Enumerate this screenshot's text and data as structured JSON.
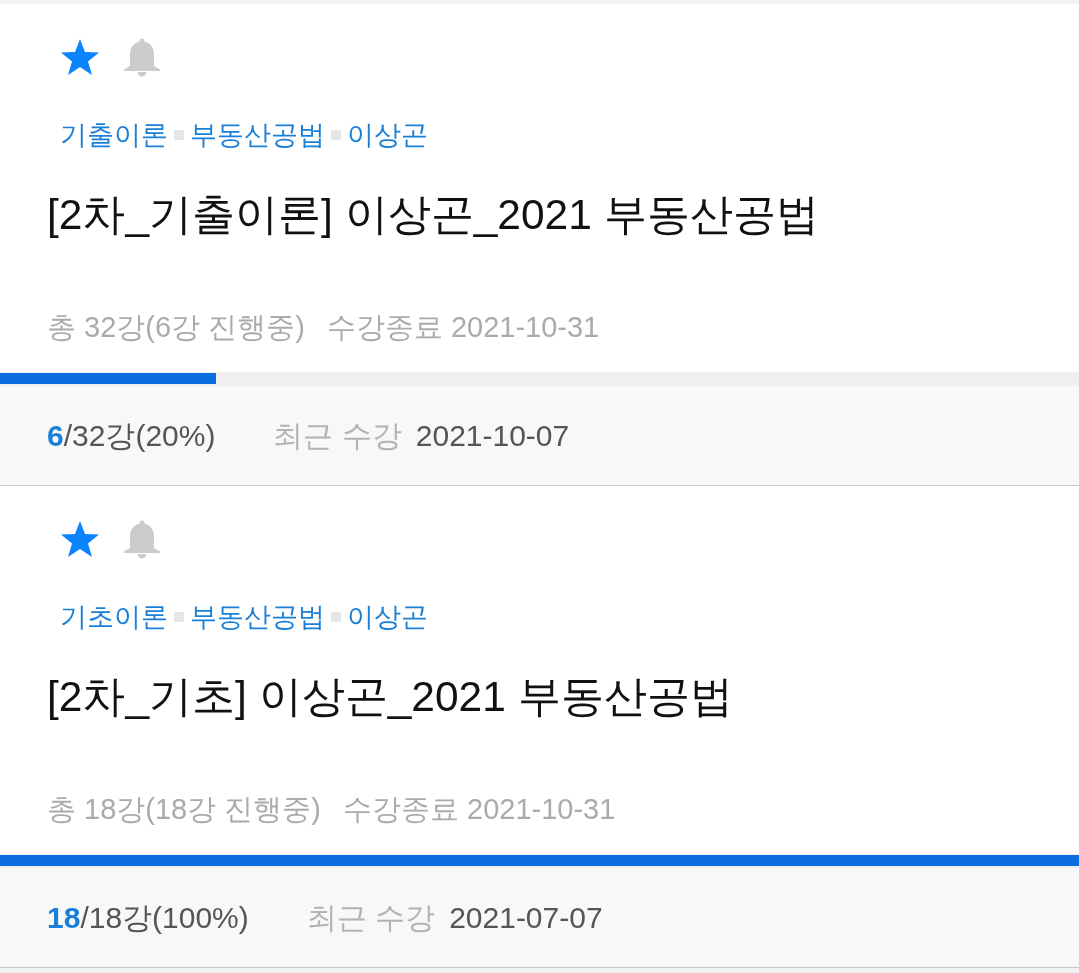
{
  "courses": [
    {
      "favorite": true,
      "alarm": false,
      "tags": [
        "기출이론",
        "부동산공법",
        "이상곤"
      ],
      "title": "[2차_기출이론] 이상곤_2021 부동산공법",
      "total": "총 32강(6강 진행중)",
      "end": "수강종료 2021-10-31",
      "level": 0.2,
      "progress": "**6**/32강(20%)",
      "recent_label": "최근 수강",
      "recent_date": "2021-10-07"
    },
    {
      "favorite": true,
      "alarm": false,
      "tags": [
        "기초이론",
        "부동산공법",
        "이상곤"
      ],
      "title": "[2차_기초] 이상곤_2021 부동산공법",
      "total": "총 18강(18강 진행중)",
      "end": "수강종료 2021-10-31",
      "level": 1,
      "progress": "**18**/18강(100%)",
      "recent_label": "최근 수강",
      "recent_date": "2021-07-07"
    }
  ]
}
